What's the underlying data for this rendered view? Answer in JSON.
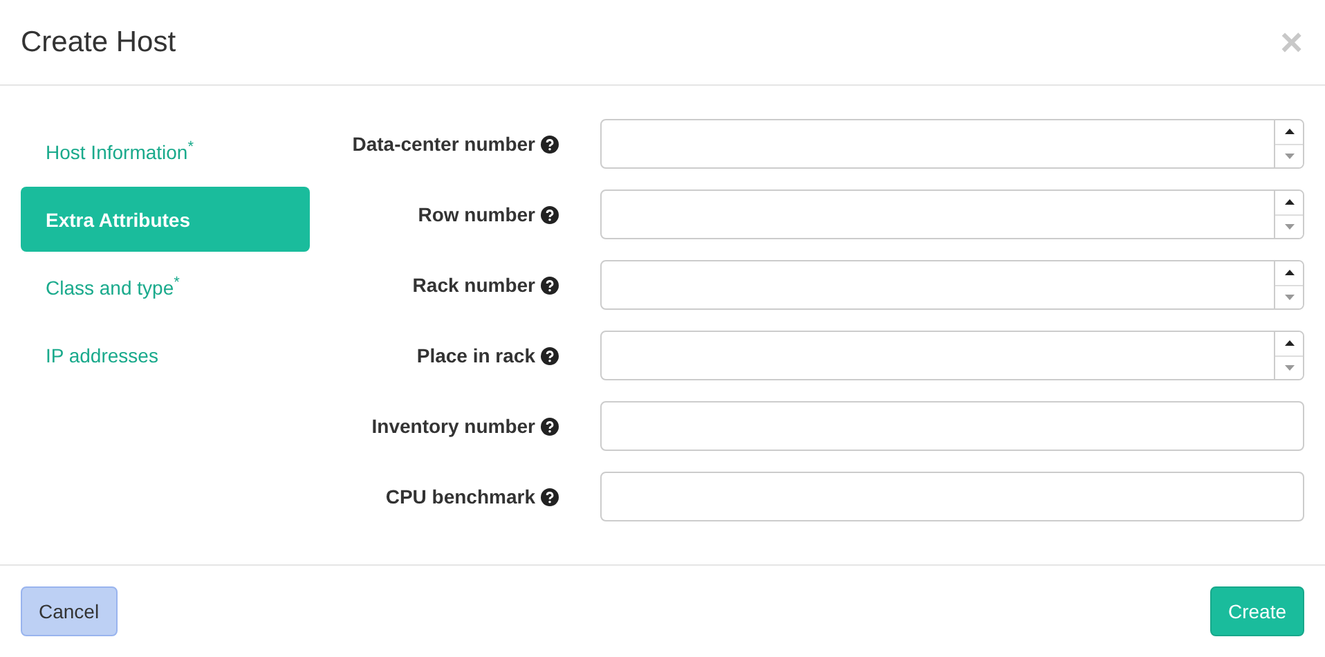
{
  "dialog": {
    "title": "Create Host",
    "close": "×"
  },
  "tabs": [
    {
      "label": "Host Information$^{*}$",
      "selected": false
    },
    {
      "label": "Extra Attributes",
      "selected": true
    },
    {
      "label": "Class and type$^{*}$",
      "selected": false
    },
    {
      "label": "IP  addresses",
      "selected": false
    }
  ],
  "fields": [
    {
      "label": "Data-center number",
      "kind": "number"
    },
    {
      "label": "Row number",
      "kind": "number"
    },
    {
      "label": "Rack number",
      "kind": "number"
    },
    {
      "label": "Place in rack",
      "kind": "number"
    },
    {
      "label": "Inventory number",
      "kind": "text"
    },
    {
      "label": "CPU benchmark",
      "kind": "text"
    }
  ],
  "buttons": [
    {
      "label": "Cancel",
      "kind": "secondary"
    },
    {
      "label": "Create",
      "kind": "primary"
    }
  ]
}
